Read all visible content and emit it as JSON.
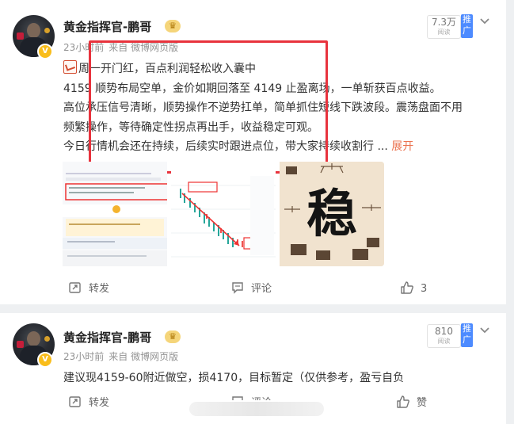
{
  "post1": {
    "author": "黄金指挥官-鹏哥",
    "time": "23小时前",
    "source": "来自 微博网页版",
    "reads_num": "7.3万",
    "reads_label": "阅读",
    "promote": "推广",
    "lines": [
      "周一开门红，百点利润轻松收入囊中",
      "4159 顺势布局空单，金价如期回落至 4149 止盈离场，一单斩获百点收益。",
      "高位承压信号清晰，顺势操作不逆势扛单，简单抓住短线下跌波段。震荡盘面不用",
      "频繁操作，等待确定性拐点再出手，收益稳定可观。",
      "今日行情机会还在持续，后续实时跟进点位，带大家持续收割行"
    ],
    "expand": "展开",
    "ellipsis": " ... ",
    "thumb3_char": "稳",
    "repost": "转发",
    "comment": "评论",
    "likes": "3"
  },
  "post2": {
    "author": "黄金指挥官-鹏哥",
    "time": "23小时前",
    "source": "来自 微博网页版",
    "reads_num": "810",
    "reads_label": "阅读",
    "promote": "推广",
    "text": "建议现4159-60附近做空，损4170，目标暂定（仅供参考，盈亏自负",
    "repost": "转发",
    "comment": "评论",
    "like": "赞"
  },
  "colors": {
    "accent": "#eb7350",
    "highlight_frame": "#e8333d",
    "promote_bg": "#4d8bff"
  }
}
